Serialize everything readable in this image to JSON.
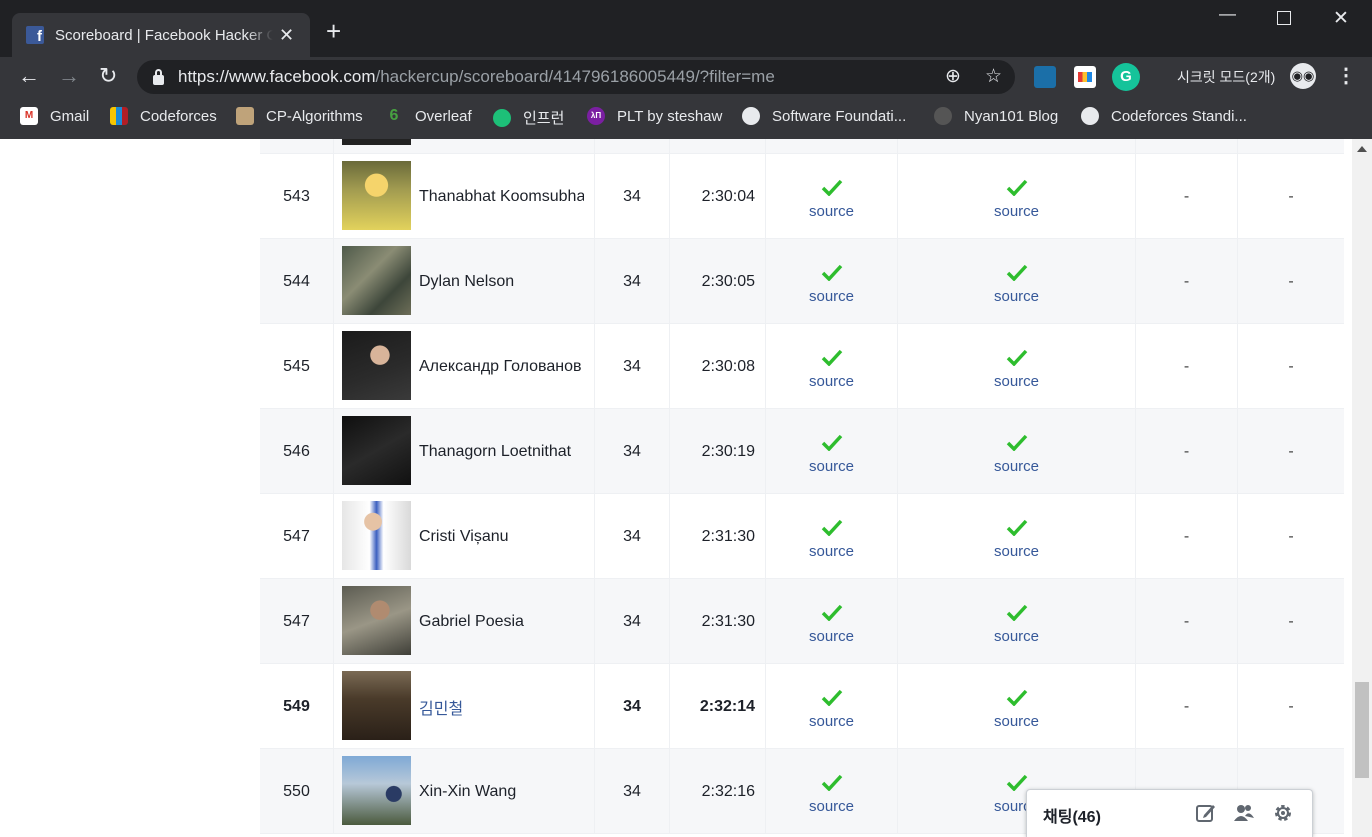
{
  "browser": {
    "tab_title": "Scoreboard | Facebook Hacker Cup",
    "tab_close": "✕",
    "new_tab": "+",
    "url_host": "https://www.facebook.com",
    "url_path": "/hackercup/scoreboard/414796186005449/?filter=me",
    "incognito_label": "시크릿 모드(2개)",
    "bookmarks": [
      "Gmail",
      "Codeforces",
      "CP-Algorithms",
      "Overleaf",
      "인프런",
      "PLT by steshaw",
      "Software Foundati...",
      "Nyan101 Blog",
      "Codeforces Standi..."
    ]
  },
  "scoreboard": {
    "source_label": "source",
    "dash": "-",
    "rows": [
      {
        "rank": "",
        "name": "",
        "score": "",
        "time": "",
        "p1": "",
        "p2": ""
      },
      {
        "rank": "543",
        "name": "Thanabhat Koomsubha",
        "score": "34",
        "time": "2:30:04",
        "p1": "solved",
        "p2": "solved",
        "p3": "-",
        "p4": "-"
      },
      {
        "rank": "544",
        "name": "Dylan Nelson",
        "score": "34",
        "time": "2:30:05",
        "p1": "solved",
        "p2": "solved",
        "p3": "-",
        "p4": "-"
      },
      {
        "rank": "545",
        "name": "Александр Голованов",
        "score": "34",
        "time": "2:30:08",
        "p1": "solved",
        "p2": "solved",
        "p3": "-",
        "p4": "-"
      },
      {
        "rank": "546",
        "name": "Thanagorn Loetnithat",
        "score": "34",
        "time": "2:30:19",
        "p1": "solved",
        "p2": "solved",
        "p3": "-",
        "p4": "-"
      },
      {
        "rank": "547",
        "name": "Cristi Vișanu",
        "score": "34",
        "time": "2:31:30",
        "p1": "solved",
        "p2": "solved",
        "p3": "-",
        "p4": "-"
      },
      {
        "rank": "547",
        "name": "Gabriel Poesia",
        "score": "34",
        "time": "2:31:30",
        "p1": "solved",
        "p2": "solved",
        "p3": "-",
        "p4": "-"
      },
      {
        "rank": "549",
        "name": "김민철",
        "score": "34",
        "time": "2:32:14",
        "p1": "solved",
        "p2": "solved",
        "p3": "-",
        "p4": "-",
        "is_me": true
      },
      {
        "rank": "550",
        "name": "Xin-Xin Wang",
        "score": "34",
        "time": "2:32:16",
        "p1": "solved",
        "p2": "solved",
        "p3": "-",
        "p4": "-"
      }
    ]
  },
  "chat": {
    "label": "채팅(46)"
  },
  "colors": {
    "check_green": "#2ebd2e",
    "link_blue": "#365899",
    "chrome_dark": "#202124"
  }
}
